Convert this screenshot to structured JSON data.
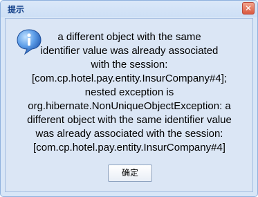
{
  "dialog": {
    "title": "提示",
    "close_glyph": "✕",
    "icon": "info-icon",
    "message": "a different object with the same\nidentifier value was already associated\nwith the session:\n[com.cp.hotel.pay.entity.InsurCompany#4];\nnested exception is\norg.hibernate.NonUniqueObjectException: a\ndifferent object with the same identifier value\nwas already associated with the session:\n[com.cp.hotel.pay.entity.InsurCompany#4]",
    "ok_label": "确定"
  },
  "colors": {
    "title_text": "#15428b",
    "close_button": "#d9583f",
    "dialog_background": "#d8e6f7",
    "icon_fill": "#3b7fd6"
  }
}
